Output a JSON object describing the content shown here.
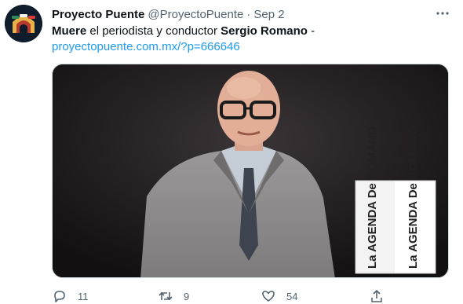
{
  "tweet": {
    "display_name": "Proyecto Puente",
    "handle": "@ProyectoPuente",
    "separator": "·",
    "date": "Sep 2",
    "text": {
      "part1": "Muere",
      "part2": " el periodista y conductor ",
      "part3": "Sergio Romano",
      "part4": " -",
      "link": "proyectopuente.com.mx/?p=666646"
    },
    "media": {
      "box_text_front": "La AGENDA De ROMANO",
      "box_text_side": "La AGENDA De ROMANO"
    },
    "actions": {
      "reply_count": "11",
      "retweet_count": "9",
      "like_count": "54"
    }
  },
  "icons": {
    "avatar": "proyecto-puente-logo",
    "more": "more-icon",
    "reply": "reply-icon",
    "retweet": "retweet-icon",
    "like": "heart-icon",
    "share": "share-icon"
  },
  "colors": {
    "link": "#1d9bf0",
    "secondary_text": "#536471",
    "primary_text": "#0f1419"
  }
}
